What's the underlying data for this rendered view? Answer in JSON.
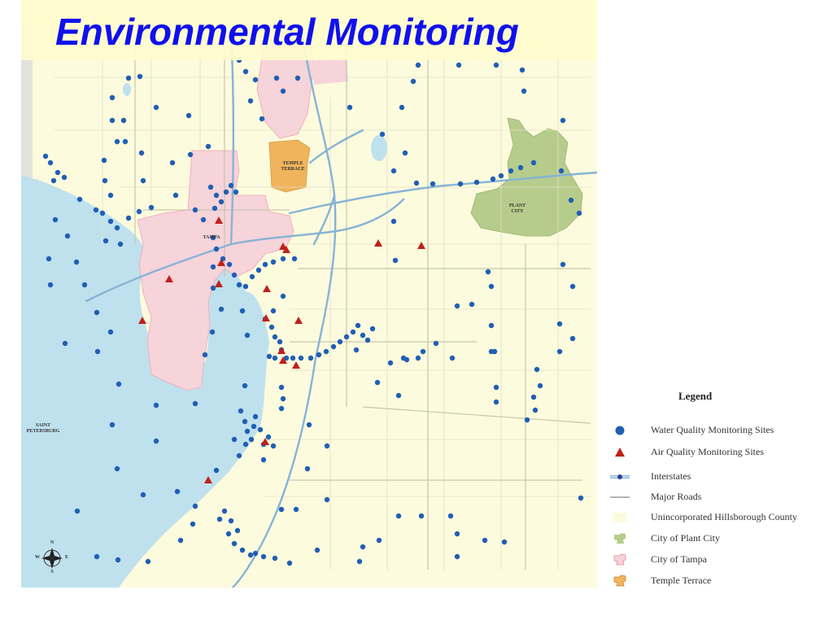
{
  "slide": {
    "title": "Environmental Monitoring"
  },
  "map": {
    "place_labels": [
      {
        "id": "temple-terrace",
        "text": "TEMPLE\nTERRACE"
      },
      {
        "id": "tampa",
        "text": "TAMPA"
      },
      {
        "id": "plant-city",
        "text": "PLANT\nCITY"
      },
      {
        "id": "saint-petersburg",
        "text": "SAINT\nPETERSBURG"
      }
    ],
    "compass": {
      "n": "N",
      "s": "S",
      "e": "E",
      "w": "W"
    },
    "colors": {
      "water": "#bfe1ee",
      "land": "#fdfbdd",
      "tampa": "#f7d3da",
      "plant_city": "#b6cc8c",
      "temple_terrace": "#f0b55c",
      "water_site": "#1f5fb5",
      "air_site": "#c0211a",
      "interstate": "#7fb0d6",
      "road": "#dcdcc6"
    }
  },
  "legend": {
    "title": "Legend",
    "items": [
      {
        "id": "water-quality",
        "label": "Water Quality Monitoring Sites",
        "swatch": "water-site-icon"
      },
      {
        "id": "air-quality",
        "label": "Air Quality Monitoring Sites",
        "swatch": "air-site-icon"
      },
      {
        "id": "interstates",
        "label": "Interstates",
        "swatch": "interstate-icon"
      },
      {
        "id": "major-roads",
        "label": "Major Roads",
        "swatch": "major-road-icon"
      },
      {
        "id": "unincorporated",
        "label": "Unincorporated Hillsborough County",
        "swatch": "unincorporated-area-icon"
      },
      {
        "id": "plant-city",
        "label": "City of Plant City",
        "swatch": "plant-city-area-icon"
      },
      {
        "id": "tampa",
        "label": "City of Tampa",
        "swatch": "tampa-area-icon"
      },
      {
        "id": "temple-terrace",
        "label": "Temple Terrace",
        "swatch": "temple-terrace-area-icon"
      }
    ]
  }
}
